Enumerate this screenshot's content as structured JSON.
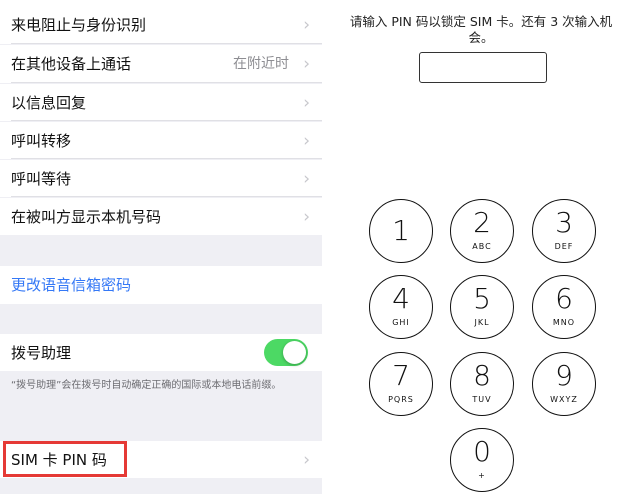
{
  "settings": {
    "rows": [
      {
        "label": "来电阻止与身份识别"
      },
      {
        "label": "在其他设备上通话",
        "value": "在附近时"
      },
      {
        "label": "以信息回复"
      },
      {
        "label": "呼叫转移"
      },
      {
        "label": "呼叫等待"
      },
      {
        "label": "在被叫方显示本机号码"
      }
    ],
    "voicemail_link": "更改语音信箱密码",
    "dial_assist": {
      "label": "拨号助理",
      "toggle_on": true
    },
    "dial_assist_note": "“拨号助理”会在拨号时自动确定正确的国际或本地电话前缀。",
    "sim_pin": {
      "label": "SIM 卡 PIN 码"
    },
    "chevron": "›"
  },
  "pin": {
    "prompt_line1": "请输入 PIN 码以锁定 SIM 卡。还有 3 次输入机",
    "prompt_line2": "会。",
    "keys": [
      {
        "digit": "1",
        "letters": ""
      },
      {
        "digit": "2",
        "letters": "ABC"
      },
      {
        "digit": "3",
        "letters": "DEF"
      },
      {
        "digit": "4",
        "letters": "GHI"
      },
      {
        "digit": "5",
        "letters": "JKL"
      },
      {
        "digit": "6",
        "letters": "MNO"
      },
      {
        "digit": "7",
        "letters": "PQRS"
      },
      {
        "digit": "8",
        "letters": "TUV"
      },
      {
        "digit": "9",
        "letters": "WXYZ"
      },
      {
        "digit": "0",
        "letters": "+"
      }
    ]
  },
  "colors": {
    "accent_link": "#3478f6",
    "toggle_on": "#4cd964",
    "highlight_border": "#e53935"
  }
}
